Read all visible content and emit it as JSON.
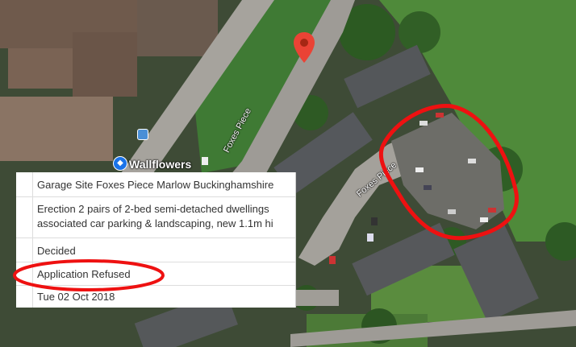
{
  "map": {
    "poi_label": "Wallflowers",
    "road_labels": [
      "Foxes Piece",
      "Foxes Piece"
    ],
    "icons": [
      "map-pin-icon",
      "shopping-bag-icon",
      "bus-stop-icon"
    ],
    "colors": {
      "pin": "#ea4335",
      "highlight": "#ee1111",
      "poi": "#1a73e8"
    }
  },
  "record": {
    "address": "Garage Site Foxes Piece Marlow Buckinghamshire",
    "proposal_line1": "Erection 2 pairs of 2-bed semi-detached dwellings",
    "proposal_line2": "associated car parking & landscaping, new 1.1m hi",
    "status": "Decided",
    "decision": "Application Refused",
    "date": "Tue 02 Oct 2018"
  }
}
